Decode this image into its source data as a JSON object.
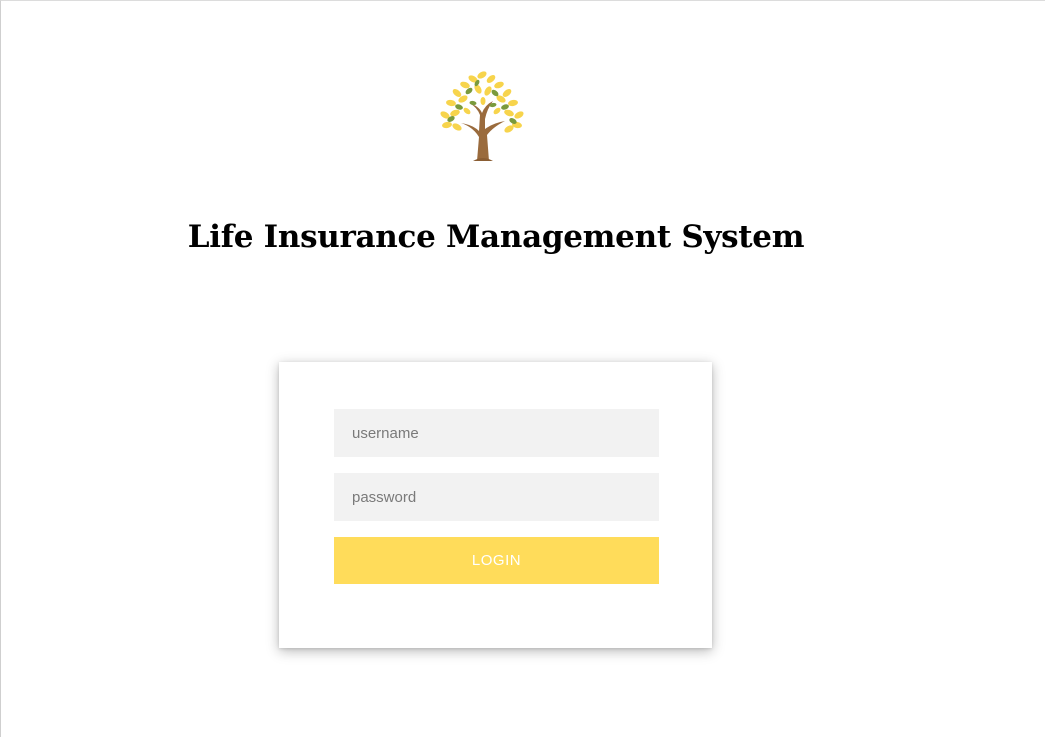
{
  "header": {
    "logo_icon": "tree-icon",
    "title": "Life Insurance Management System"
  },
  "login_form": {
    "username": {
      "placeholder": "username",
      "value": ""
    },
    "password": {
      "placeholder": "password",
      "value": ""
    },
    "login_label": "LOGIN"
  },
  "colors": {
    "button_background": "#ffdc5a",
    "input_background": "#f2f2f2",
    "tree_trunk": "#9a6b3d",
    "leaf_yellow": "#f7d44c",
    "leaf_green": "#7a9a3c"
  }
}
